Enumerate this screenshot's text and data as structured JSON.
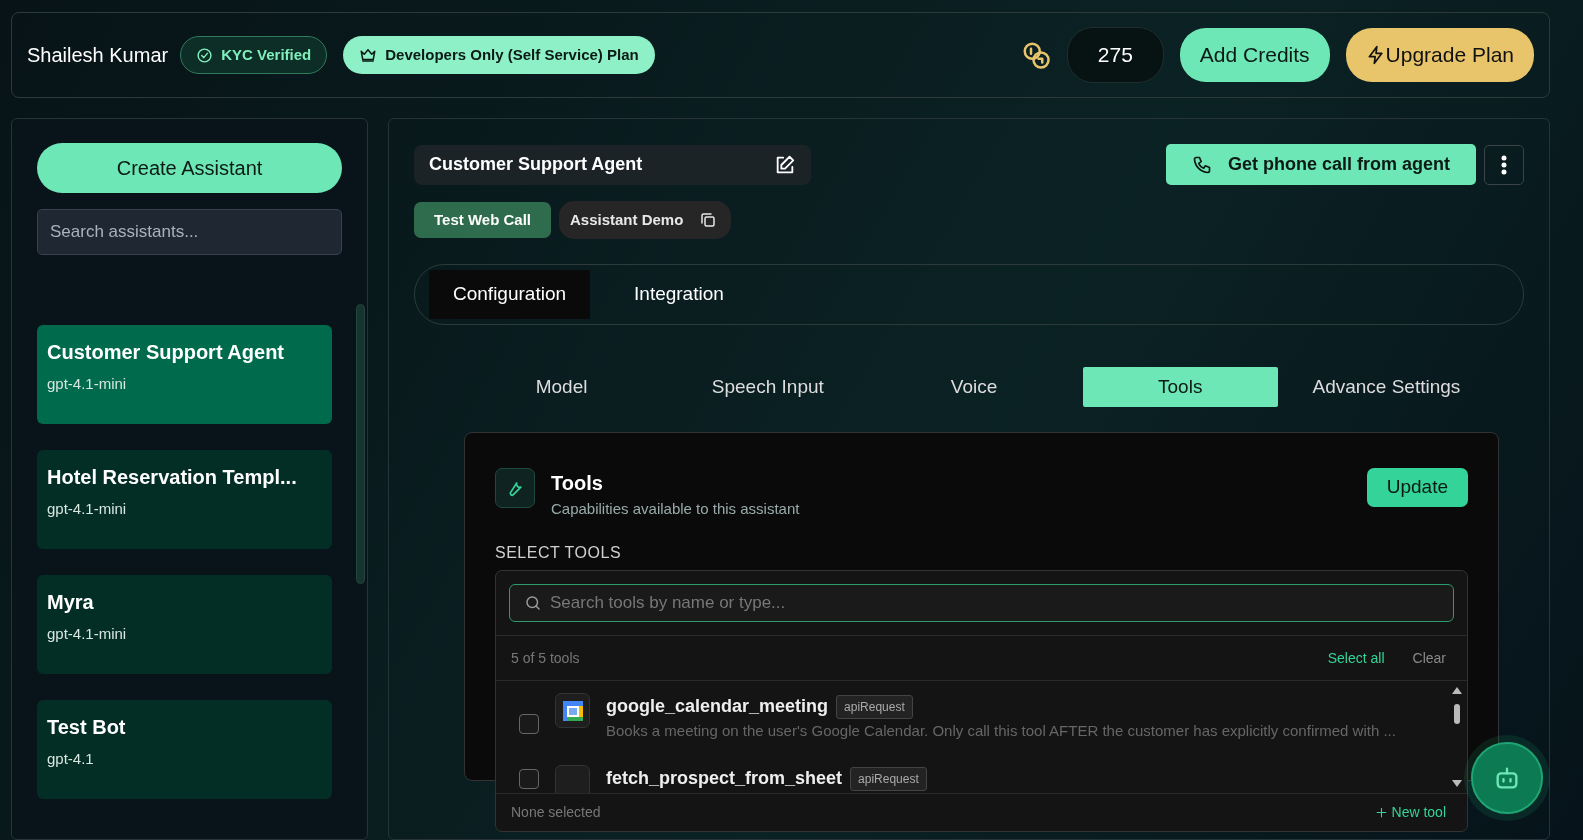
{
  "header": {
    "user_name": "Shailesh Kumar",
    "kyc_badge": "KYC Verified",
    "plan_badge": "Developers Only (Self Service) Plan",
    "credits": "275",
    "add_credits": "Add Credits",
    "upgrade": "Upgrade Plan"
  },
  "sidebar": {
    "create_button": "Create Assistant",
    "search": {
      "placeholder": "Search assistants..."
    },
    "assistants": [
      {
        "name": "Customer Support Agent",
        "model": "gpt-4.1-mini",
        "selected": true
      },
      {
        "name": "Hotel Reservation Templ...",
        "model": "gpt-4.1-mini",
        "selected": false
      },
      {
        "name": "Myra",
        "model": "gpt-4.1-mini",
        "selected": false
      },
      {
        "name": "Test Bot",
        "model": "gpt-4.1",
        "selected": false
      }
    ]
  },
  "assistant": {
    "title": "Customer Support Agent",
    "call_button": "Get phone call from agent",
    "test_button": "Test Web Call",
    "demo_button": "Assistant Demo"
  },
  "tabs": [
    {
      "label": "Configuration",
      "selected": true
    },
    {
      "label": "Integration",
      "selected": false
    }
  ],
  "subtabs": [
    {
      "label": "Model",
      "selected": false
    },
    {
      "label": "Speech Input",
      "selected": false
    },
    {
      "label": "Voice",
      "selected": false
    },
    {
      "label": "Tools",
      "selected": true
    },
    {
      "label": "Advance Settings",
      "selected": false
    }
  ],
  "tools_card": {
    "title": "Tools",
    "subtitle": "Capabilities available to this assistant",
    "update_button": "Update",
    "section_label": "SELECT TOOLS"
  },
  "dropdown": {
    "search": {
      "placeholder": "Search tools by name or type..."
    },
    "count": "5 of 5 tools",
    "select_all": "Select all",
    "clear": "Clear",
    "tools": [
      {
        "name": "google_calendar_meeting",
        "type": "apiRequest",
        "description": "Books a meeting on the user's Google Calendar. Only call this tool AFTER the customer has explicitly confirmed with ...",
        "checked": false
      },
      {
        "name": "fetch_prospect_from_sheet",
        "type": "apiRequest",
        "checked": false
      }
    ],
    "footer_status": "None selected",
    "new_tool": "New tool"
  }
}
